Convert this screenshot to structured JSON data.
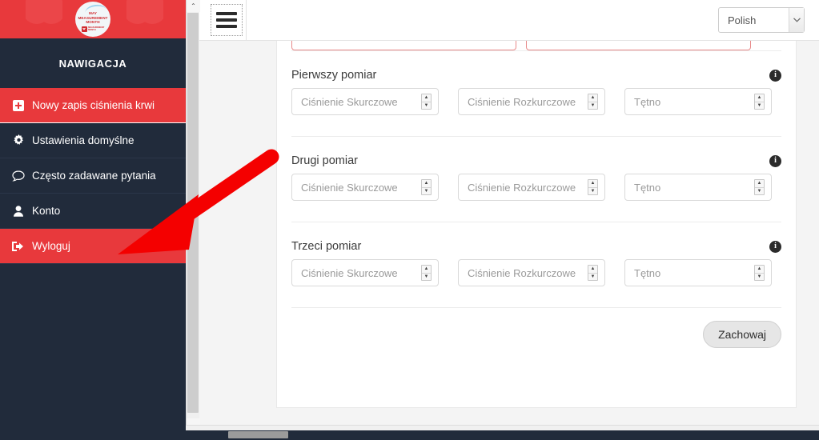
{
  "sidebar": {
    "logo": {
      "icon": "may-measurement-month-logo",
      "title_line1": "MAY",
      "title_line2": "MEASUREMENT",
      "title_line3": "MONTH",
      "sub_line1": "MEASUREMENT",
      "sub_line2": "MONTH"
    },
    "header": "NAWIGACJA",
    "items": [
      {
        "label": "Nowy zapis ciśnienia krwi",
        "icon": "plus-square-icon",
        "state": "active"
      },
      {
        "label": "Ustawienia domyślne",
        "icon": "gear-icon",
        "state": "normal"
      },
      {
        "label": "Często zadawane pytania",
        "icon": "comment-icon",
        "state": "normal"
      },
      {
        "label": "Konto",
        "icon": "user-icon",
        "state": "normal"
      },
      {
        "label": "Wyloguj",
        "icon": "sign-out-icon",
        "state": "active"
      }
    ]
  },
  "topbar": {
    "menu_toggle_icon": "hamburger-icon",
    "language": {
      "selected": "Polish",
      "arrow_icon": "chevron-down-icon"
    }
  },
  "form": {
    "measurements": [
      {
        "title": "Pierwszy pomiar",
        "info_icon": "info-circle-icon",
        "fields": [
          {
            "placeholder": "Ciśnienie Skurczowe",
            "value": "",
            "name": "systolic"
          },
          {
            "placeholder": "Ciśnienie Rozkurczowe",
            "value": "",
            "name": "diastolic"
          },
          {
            "placeholder": "Tętno",
            "value": "",
            "name": "pulse"
          }
        ]
      },
      {
        "title": "Drugi pomiar",
        "info_icon": "info-circle-icon",
        "fields": [
          {
            "placeholder": "Ciśnienie Skurczowe",
            "value": "",
            "name": "systolic"
          },
          {
            "placeholder": "Ciśnienie Rozkurczowe",
            "value": "",
            "name": "diastolic"
          },
          {
            "placeholder": "Tętno",
            "value": "",
            "name": "pulse"
          }
        ]
      },
      {
        "title": "Trzeci pomiar",
        "info_icon": "info-circle-icon",
        "fields": [
          {
            "placeholder": "Ciśnienie Skurczowe",
            "value": "",
            "name": "systolic"
          },
          {
            "placeholder": "Ciśnienie Rozkurczowe",
            "value": "",
            "name": "diastolic"
          },
          {
            "placeholder": "Tętno",
            "value": "",
            "name": "pulse"
          }
        ]
      }
    ],
    "save_label": "Zachowaj",
    "spinner_up": "▲",
    "spinner_down": "▼"
  },
  "scrollbars": {
    "up_arrow": "⌃",
    "down_arrow": "⌄",
    "left_arrow": "‹"
  },
  "annotation": {
    "type": "red-arrow",
    "points_to": "Wyloguj",
    "color": "#f40000"
  },
  "colors": {
    "brand_red": "#e8393c",
    "sidebar_dark": "#212b3b",
    "page_bg": "#f4f4f4",
    "invalid_border": "#e88a8a",
    "annotation_red": "#f40000"
  }
}
